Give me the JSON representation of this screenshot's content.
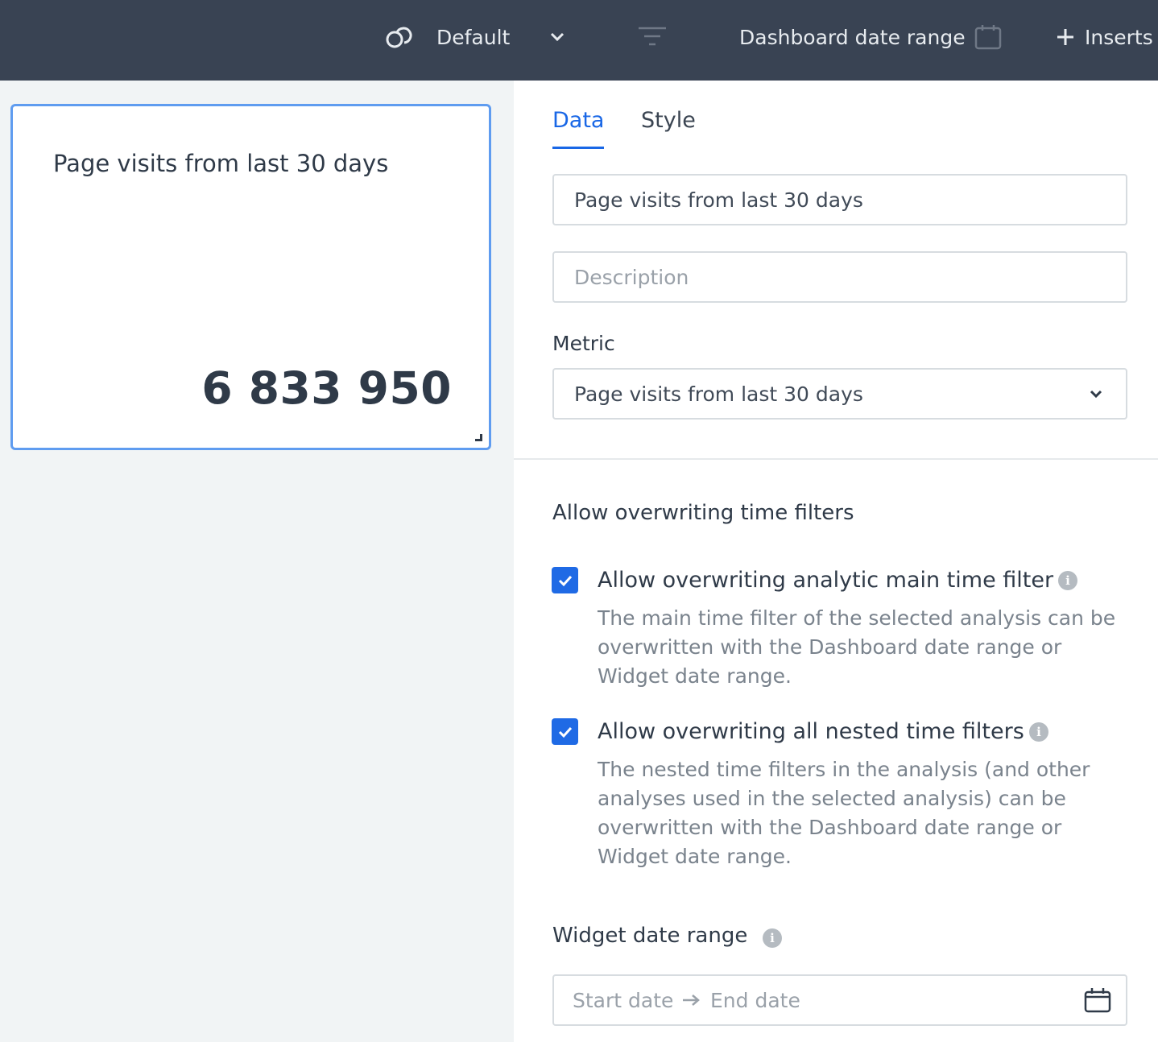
{
  "topbar": {
    "layout_icon": "overlapping-circles-icon",
    "layout_label": "Default",
    "filter_icon": "filter-lines-icon",
    "date_range_label": "Dashboard date range",
    "inserts_label": "Inserts",
    "background_color": "#394353"
  },
  "widget": {
    "title": "Page visits from last 30 days",
    "value": "6 833 950",
    "border_color": "#5f9cf0"
  },
  "panel": {
    "tabs": [
      {
        "label": "Data",
        "active": true
      },
      {
        "label": "Style",
        "active": false
      }
    ],
    "name_field_value": "Page visits from last 30 days",
    "description_placeholder": "Description",
    "metric_label": "Metric",
    "metric_value": "Page visits from last 30 days",
    "time_filters": {
      "title": "Allow overwriting time filters",
      "options": [
        {
          "checked": true,
          "title": "Allow overwriting analytic main time filter",
          "description": "The main time filter of the selected analysis can be overwritten with the Dashboard date range or Widget date range."
        },
        {
          "checked": true,
          "title": "Allow overwriting all nested time filters",
          "description": "The nested time filters in the analysis (and other analyses used in the selected analysis) can be overwritten with the Dashboard date range or Widget date range."
        }
      ]
    },
    "widget_date_range": {
      "label": "Widget date range",
      "start_placeholder": "Start date",
      "end_placeholder": "End date"
    }
  },
  "colors": {
    "accent": "#1967e6",
    "checkbox": "#1f6ae5",
    "canvas_bg": "#f1f4f5"
  }
}
